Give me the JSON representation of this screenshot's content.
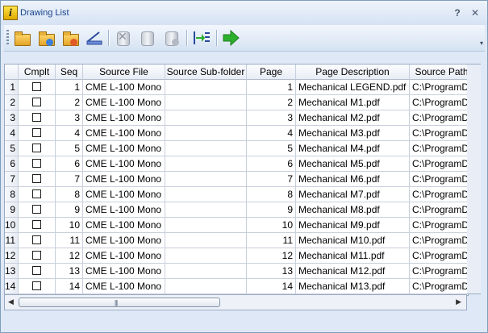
{
  "window": {
    "title": "Drawing List",
    "help_label": "?",
    "close_label": "✕"
  },
  "toolbar": {
    "icons": [
      "open-folder-icon",
      "add-folder-icon",
      "folder-refresh-icon",
      "scan-icon",
      "delete-icon",
      "stack-icon",
      "stack-add-icon",
      "import-list-icon",
      "go-arrow-icon"
    ],
    "overflow_label": "▾"
  },
  "grid": {
    "columns": [
      "Cmplt",
      "Seq",
      "Source File",
      "Source Sub-folder",
      "Page",
      "Page Description",
      "Source Path"
    ],
    "rows": [
      {
        "row": "1",
        "seq": "1",
        "file": "CME L-100 Mono",
        "sub": "",
        "page": "1",
        "desc": "Mechanical LEGEND.pdf",
        "path": "C:\\ProgramD"
      },
      {
        "row": "2",
        "seq": "2",
        "file": "CME L-100 Mono",
        "sub": "",
        "page": "2",
        "desc": "Mechanical M1.pdf",
        "path": "C:\\ProgramD"
      },
      {
        "row": "3",
        "seq": "3",
        "file": "CME L-100 Mono",
        "sub": "",
        "page": "3",
        "desc": "Mechanical M2.pdf",
        "path": "C:\\ProgramD"
      },
      {
        "row": "4",
        "seq": "4",
        "file": "CME L-100 Mono",
        "sub": "",
        "page": "4",
        "desc": "Mechanical M3.pdf",
        "path": "C:\\ProgramD"
      },
      {
        "row": "5",
        "seq": "5",
        "file": "CME L-100 Mono",
        "sub": "",
        "page": "5",
        "desc": "Mechanical M4.pdf",
        "path": "C:\\ProgramD"
      },
      {
        "row": "6",
        "seq": "6",
        "file": "CME L-100 Mono",
        "sub": "",
        "page": "6",
        "desc": "Mechanical M5.pdf",
        "path": "C:\\ProgramD"
      },
      {
        "row": "7",
        "seq": "7",
        "file": "CME L-100 Mono",
        "sub": "",
        "page": "7",
        "desc": "Mechanical M6.pdf",
        "path": "C:\\ProgramD"
      },
      {
        "row": "8",
        "seq": "8",
        "file": "CME L-100 Mono",
        "sub": "",
        "page": "8",
        "desc": "Mechanical M7.pdf",
        "path": "C:\\ProgramD"
      },
      {
        "row": "9",
        "seq": "9",
        "file": "CME L-100 Mono",
        "sub": "",
        "page": "9",
        "desc": "Mechanical M8.pdf",
        "path": "C:\\ProgramD"
      },
      {
        "row": "10",
        "seq": "10",
        "file": "CME L-100 Mono",
        "sub": "",
        "page": "10",
        "desc": "Mechanical M9.pdf",
        "path": "C:\\ProgramD"
      },
      {
        "row": "11",
        "seq": "11",
        "file": "CME L-100 Mono",
        "sub": "",
        "page": "11",
        "desc": "Mechanical M10.pdf",
        "path": "C:\\ProgramD"
      },
      {
        "row": "12",
        "seq": "12",
        "file": "CME L-100 Mono",
        "sub": "",
        "page": "12",
        "desc": "Mechanical M11.pdf",
        "path": "C:\\ProgramD"
      },
      {
        "row": "13",
        "seq": "13",
        "file": "CME L-100 Mono",
        "sub": "",
        "page": "13",
        "desc": "Mechanical M12.pdf",
        "path": "C:\\ProgramD"
      },
      {
        "row": "14",
        "seq": "14",
        "file": "CME L-100 Mono",
        "sub": "",
        "page": "14",
        "desc": "Mechanical M13.pdf",
        "path": "C:\\ProgramD"
      }
    ]
  },
  "scrollbar": {
    "left_arrow": "◀",
    "right_arrow": "▶",
    "grip": "|||"
  },
  "colors": {
    "accent": "#15428b",
    "frame": "#dfe8f6",
    "go_arrow": "#2cb02c"
  }
}
